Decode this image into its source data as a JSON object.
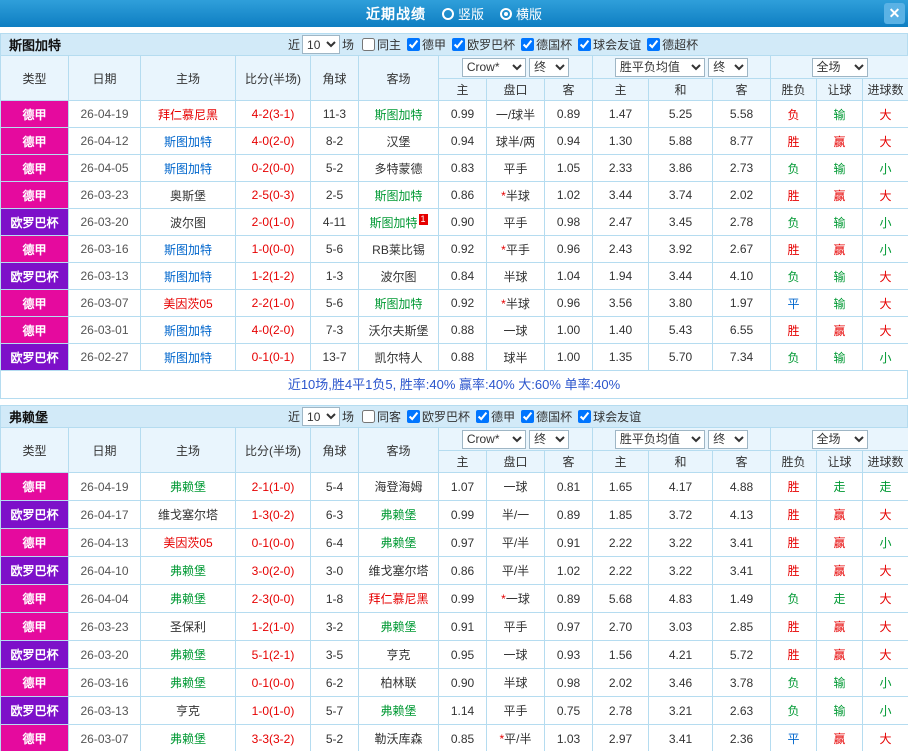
{
  "topbar": {
    "title": "近期战绩",
    "radio_vertical": "竖版",
    "radio_horizontal": "横版",
    "close": "✕"
  },
  "league_colors": {
    "德甲": "#e50a9e",
    "欧罗巴杯": "#7d10c9"
  },
  "text_colors": {
    "red": "#e60000",
    "green": "#009933",
    "blue": "#0066cc",
    "black": "#333333"
  },
  "columns": [
    "类型",
    "日期",
    "主场",
    "比分(半场)",
    "角球",
    "客场"
  ],
  "subcolumns": [
    "主",
    "盘口",
    "客",
    "主",
    "和",
    "客",
    "胜负",
    "让球",
    "进球数"
  ],
  "selects": {
    "count": "10",
    "company": "Crow*",
    "final": "终",
    "avg": "胜平负均值",
    "scope": "全场"
  },
  "near_label": "近",
  "games_label": "场",
  "sections": [
    {
      "team": "斯图加特",
      "filters": [
        {
          "label": "同主",
          "checked": false
        },
        {
          "label": "德甲",
          "checked": true
        },
        {
          "label": "欧罗巴杯",
          "checked": true
        },
        {
          "label": "德国杯",
          "checked": true
        },
        {
          "label": "球会友谊",
          "checked": true
        },
        {
          "label": "德超杯",
          "checked": true
        }
      ],
      "summary": "近10场,胜4平1负5, 胜率:40% 赢率:40% 大:60% 单率:40%",
      "rows": [
        {
          "league": "德甲",
          "date": "26-04-19",
          "home": "拜仁慕尼黑",
          "home_color": "red",
          "score": "4-2(3-1)",
          "corner": "11-3",
          "away": "斯图加特",
          "away_color": "green",
          "away_card": 0,
          "ah_home": "0.99",
          "handicap": "一/球半",
          "ah_away": "0.89",
          "eu_home": "1.47",
          "eu_draw": "5.25",
          "eu_away": "5.58",
          "result": "负",
          "result_color": "red",
          "ah_result": "输",
          "ah_result_color": "green",
          "ou_result": "大",
          "ou_result_color": "red"
        },
        {
          "league": "德甲",
          "date": "26-04-12",
          "home": "斯图加特",
          "home_color": "blue",
          "score": "4-0(2-0)",
          "corner": "8-2",
          "away": "汉堡",
          "away_color": "black",
          "away_card": 0,
          "ah_home": "0.94",
          "handicap": "球半/两",
          "ah_away": "0.94",
          "eu_home": "1.30",
          "eu_draw": "5.88",
          "eu_away": "8.77",
          "result": "胜",
          "result_color": "red",
          "ah_result": "赢",
          "ah_result_color": "red",
          "ou_result": "大",
          "ou_result_color": "red"
        },
        {
          "league": "德甲",
          "date": "26-04-05",
          "home": "斯图加特",
          "home_color": "blue",
          "score": "0-2(0-0)",
          "corner": "5-2",
          "away": "多特蒙德",
          "away_color": "black",
          "away_card": 0,
          "ah_home": "0.83",
          "handicap": "平手",
          "ah_away": "1.05",
          "eu_home": "2.33",
          "eu_draw": "3.86",
          "eu_away": "2.73",
          "result": "负",
          "result_color": "green",
          "ah_result": "输",
          "ah_result_color": "green",
          "ou_result": "小",
          "ou_result_color": "green"
        },
        {
          "league": "德甲",
          "date": "26-03-23",
          "home": "奥斯堡",
          "home_color": "black",
          "score": "2-5(0-3)",
          "corner": "2-5",
          "away": "斯图加特",
          "away_color": "green",
          "away_card": 0,
          "ah_home": "0.86",
          "handicap": "*半球",
          "ah_away": "1.02",
          "eu_home": "3.44",
          "eu_draw": "3.74",
          "eu_away": "2.02",
          "result": "胜",
          "result_color": "red",
          "ah_result": "赢",
          "ah_result_color": "red",
          "ou_result": "大",
          "ou_result_color": "red"
        },
        {
          "league": "欧罗巴杯",
          "date": "26-03-20",
          "home": "波尔图",
          "home_color": "black",
          "score": "2-0(1-0)",
          "corner": "4-11",
          "away": "斯图加特",
          "away_color": "green",
          "away_card": 1,
          "ah_home": "0.90",
          "handicap": "平手",
          "ah_away": "0.98",
          "eu_home": "2.47",
          "eu_draw": "3.45",
          "eu_away": "2.78",
          "result": "负",
          "result_color": "green",
          "ah_result": "输",
          "ah_result_color": "green",
          "ou_result": "小",
          "ou_result_color": "green"
        },
        {
          "league": "德甲",
          "date": "26-03-16",
          "home": "斯图加特",
          "home_color": "blue",
          "score": "1-0(0-0)",
          "corner": "5-6",
          "away": "RB莱比锡",
          "away_color": "black",
          "away_card": 0,
          "ah_home": "0.92",
          "handicap": "*平手",
          "ah_away": "0.96",
          "eu_home": "2.43",
          "eu_draw": "3.92",
          "eu_away": "2.67",
          "result": "胜",
          "result_color": "red",
          "ah_result": "赢",
          "ah_result_color": "red",
          "ou_result": "小",
          "ou_result_color": "green"
        },
        {
          "league": "欧罗巴杯",
          "date": "26-03-13",
          "home": "斯图加特",
          "home_color": "blue",
          "score": "1-2(1-2)",
          "corner": "1-3",
          "away": "波尔图",
          "away_color": "black",
          "away_card": 0,
          "ah_home": "0.84",
          "handicap": "半球",
          "ah_away": "1.04",
          "eu_home": "1.94",
          "eu_draw": "3.44",
          "eu_away": "4.10",
          "result": "负",
          "result_color": "green",
          "ah_result": "输",
          "ah_result_color": "green",
          "ou_result": "大",
          "ou_result_color": "red"
        },
        {
          "league": "德甲",
          "date": "26-03-07",
          "home": "美因茨05",
          "home_color": "red",
          "score": "2-2(1-0)",
          "corner": "5-6",
          "away": "斯图加特",
          "away_color": "green",
          "away_card": 0,
          "ah_home": "0.92",
          "handicap": "*半球",
          "ah_away": "0.96",
          "eu_home": "3.56",
          "eu_draw": "3.80",
          "eu_away": "1.97",
          "result": "平",
          "result_color": "blue",
          "ah_result": "输",
          "ah_result_color": "green",
          "ou_result": "大",
          "ou_result_color": "red"
        },
        {
          "league": "德甲",
          "date": "26-03-01",
          "home": "斯图加特",
          "home_color": "blue",
          "score": "4-0(2-0)",
          "corner": "7-3",
          "away": "沃尔夫斯堡",
          "away_color": "black",
          "away_card": 0,
          "ah_home": "0.88",
          "handicap": "一球",
          "ah_away": "1.00",
          "eu_home": "1.40",
          "eu_draw": "5.43",
          "eu_away": "6.55",
          "result": "胜",
          "result_color": "red",
          "ah_result": "赢",
          "ah_result_color": "red",
          "ou_result": "大",
          "ou_result_color": "red"
        },
        {
          "league": "欧罗巴杯",
          "date": "26-02-27",
          "home": "斯图加特",
          "home_color": "blue",
          "score": "0-1(0-1)",
          "corner": "13-7",
          "away": "凯尔特人",
          "away_color": "black",
          "away_card": 0,
          "ah_home": "0.88",
          "handicap": "球半",
          "ah_away": "1.00",
          "eu_home": "1.35",
          "eu_draw": "5.70",
          "eu_away": "7.34",
          "result": "负",
          "result_color": "green",
          "ah_result": "输",
          "ah_result_color": "green",
          "ou_result": "小",
          "ou_result_color": "green"
        }
      ]
    },
    {
      "team": "弗赖堡",
      "filters": [
        {
          "label": "同客",
          "checked": false
        },
        {
          "label": "欧罗巴杯",
          "checked": true
        },
        {
          "label": "德甲",
          "checked": true
        },
        {
          "label": "德国杯",
          "checked": true
        },
        {
          "label": "球会友谊",
          "checked": true
        }
      ],
      "summary": "",
      "rows": [
        {
          "league": "德甲",
          "date": "26-04-19",
          "home": "弗赖堡",
          "home_color": "green",
          "score": "2-1(1-0)",
          "corner": "5-4",
          "away": "海登海姆",
          "away_color": "black",
          "away_card": 0,
          "ah_home": "1.07",
          "handicap": "一球",
          "ah_away": "0.81",
          "eu_home": "1.65",
          "eu_draw": "4.17",
          "eu_away": "4.88",
          "result": "胜",
          "result_color": "red",
          "ah_result": "走",
          "ah_result_color": "green",
          "ou_result": "走",
          "ou_result_color": "green"
        },
        {
          "league": "欧罗巴杯",
          "date": "26-04-17",
          "home": "维戈塞尔塔",
          "home_color": "black",
          "score": "1-3(0-2)",
          "corner": "6-3",
          "away": "弗赖堡",
          "away_color": "green",
          "away_card": 0,
          "ah_home": "0.99",
          "handicap": "半/一",
          "ah_away": "0.89",
          "eu_home": "1.85",
          "eu_draw": "3.72",
          "eu_away": "4.13",
          "result": "胜",
          "result_color": "red",
          "ah_result": "赢",
          "ah_result_color": "red",
          "ou_result": "大",
          "ou_result_color": "red"
        },
        {
          "league": "德甲",
          "date": "26-04-13",
          "home": "美因茨05",
          "home_color": "red",
          "score": "0-1(0-0)",
          "corner": "6-4",
          "away": "弗赖堡",
          "away_color": "green",
          "away_card": 0,
          "ah_home": "0.97",
          "handicap": "平/半",
          "ah_away": "0.91",
          "eu_home": "2.22",
          "eu_draw": "3.22",
          "eu_away": "3.41",
          "result": "胜",
          "result_color": "red",
          "ah_result": "赢",
          "ah_result_color": "red",
          "ou_result": "小",
          "ou_result_color": "green"
        },
        {
          "league": "欧罗巴杯",
          "date": "26-04-10",
          "home": "弗赖堡",
          "home_color": "green",
          "score": "3-0(2-0)",
          "corner": "3-0",
          "away": "维戈塞尔塔",
          "away_color": "black",
          "away_card": 0,
          "ah_home": "0.86",
          "handicap": "平/半",
          "ah_away": "1.02",
          "eu_home": "2.22",
          "eu_draw": "3.22",
          "eu_away": "3.41",
          "result": "胜",
          "result_color": "red",
          "ah_result": "赢",
          "ah_result_color": "red",
          "ou_result": "大",
          "ou_result_color": "red"
        },
        {
          "league": "德甲",
          "date": "26-04-04",
          "home": "弗赖堡",
          "home_color": "green",
          "score": "2-3(0-0)",
          "corner": "1-8",
          "away": "拜仁慕尼黑",
          "away_color": "red",
          "away_card": 0,
          "ah_home": "0.99",
          "handicap": "*一球",
          "ah_away": "0.89",
          "eu_home": "5.68",
          "eu_draw": "4.83",
          "eu_away": "1.49",
          "result": "负",
          "result_color": "green",
          "ah_result": "走",
          "ah_result_color": "green",
          "ou_result": "大",
          "ou_result_color": "red"
        },
        {
          "league": "德甲",
          "date": "26-03-23",
          "home": "圣保利",
          "home_color": "black",
          "score": "1-2(1-0)",
          "corner": "3-2",
          "away": "弗赖堡",
          "away_color": "green",
          "away_card": 0,
          "ah_home": "0.91",
          "handicap": "平手",
          "ah_away": "0.97",
          "eu_home": "2.70",
          "eu_draw": "3.03",
          "eu_away": "2.85",
          "result": "胜",
          "result_color": "red",
          "ah_result": "赢",
          "ah_result_color": "red",
          "ou_result": "大",
          "ou_result_color": "red"
        },
        {
          "league": "欧罗巴杯",
          "date": "26-03-20",
          "home": "弗赖堡",
          "home_color": "green",
          "score": "5-1(2-1)",
          "corner": "3-5",
          "away": "亨克",
          "away_color": "black",
          "away_card": 0,
          "ah_home": "0.95",
          "handicap": "一球",
          "ah_away": "0.93",
          "eu_home": "1.56",
          "eu_draw": "4.21",
          "eu_away": "5.72",
          "result": "胜",
          "result_color": "red",
          "ah_result": "赢",
          "ah_result_color": "red",
          "ou_result": "大",
          "ou_result_color": "red"
        },
        {
          "league": "德甲",
          "date": "26-03-16",
          "home": "弗赖堡",
          "home_color": "green",
          "score": "0-1(0-0)",
          "corner": "6-2",
          "away": "柏林联",
          "away_color": "black",
          "away_card": 0,
          "ah_home": "0.90",
          "handicap": "半球",
          "ah_away": "0.98",
          "eu_home": "2.02",
          "eu_draw": "3.46",
          "eu_away": "3.78",
          "result": "负",
          "result_color": "green",
          "ah_result": "输",
          "ah_result_color": "green",
          "ou_result": "小",
          "ou_result_color": "green"
        },
        {
          "league": "欧罗巴杯",
          "date": "26-03-13",
          "home": "亨克",
          "home_color": "black",
          "score": "1-0(1-0)",
          "corner": "5-7",
          "away": "弗赖堡",
          "away_color": "green",
          "away_card": 0,
          "ah_home": "1.14",
          "handicap": "平手",
          "ah_away": "0.75",
          "eu_home": "2.78",
          "eu_draw": "3.21",
          "eu_away": "2.63",
          "result": "负",
          "result_color": "green",
          "ah_result": "输",
          "ah_result_color": "green",
          "ou_result": "小",
          "ou_result_color": "green"
        },
        {
          "league": "德甲",
          "date": "26-03-07",
          "home": "弗赖堡",
          "home_color": "green",
          "score": "3-3(3-2)",
          "corner": "5-2",
          "away": "勒沃库森",
          "away_color": "black",
          "away_card": 0,
          "ah_home": "0.85",
          "handicap": "*平/半",
          "ah_away": "1.03",
          "eu_home": "2.97",
          "eu_draw": "3.41",
          "eu_away": "2.36",
          "result": "平",
          "result_color": "blue",
          "ah_result": "赢",
          "ah_result_color": "red",
          "ou_result": "大",
          "ou_result_color": "red"
        }
      ]
    }
  ]
}
